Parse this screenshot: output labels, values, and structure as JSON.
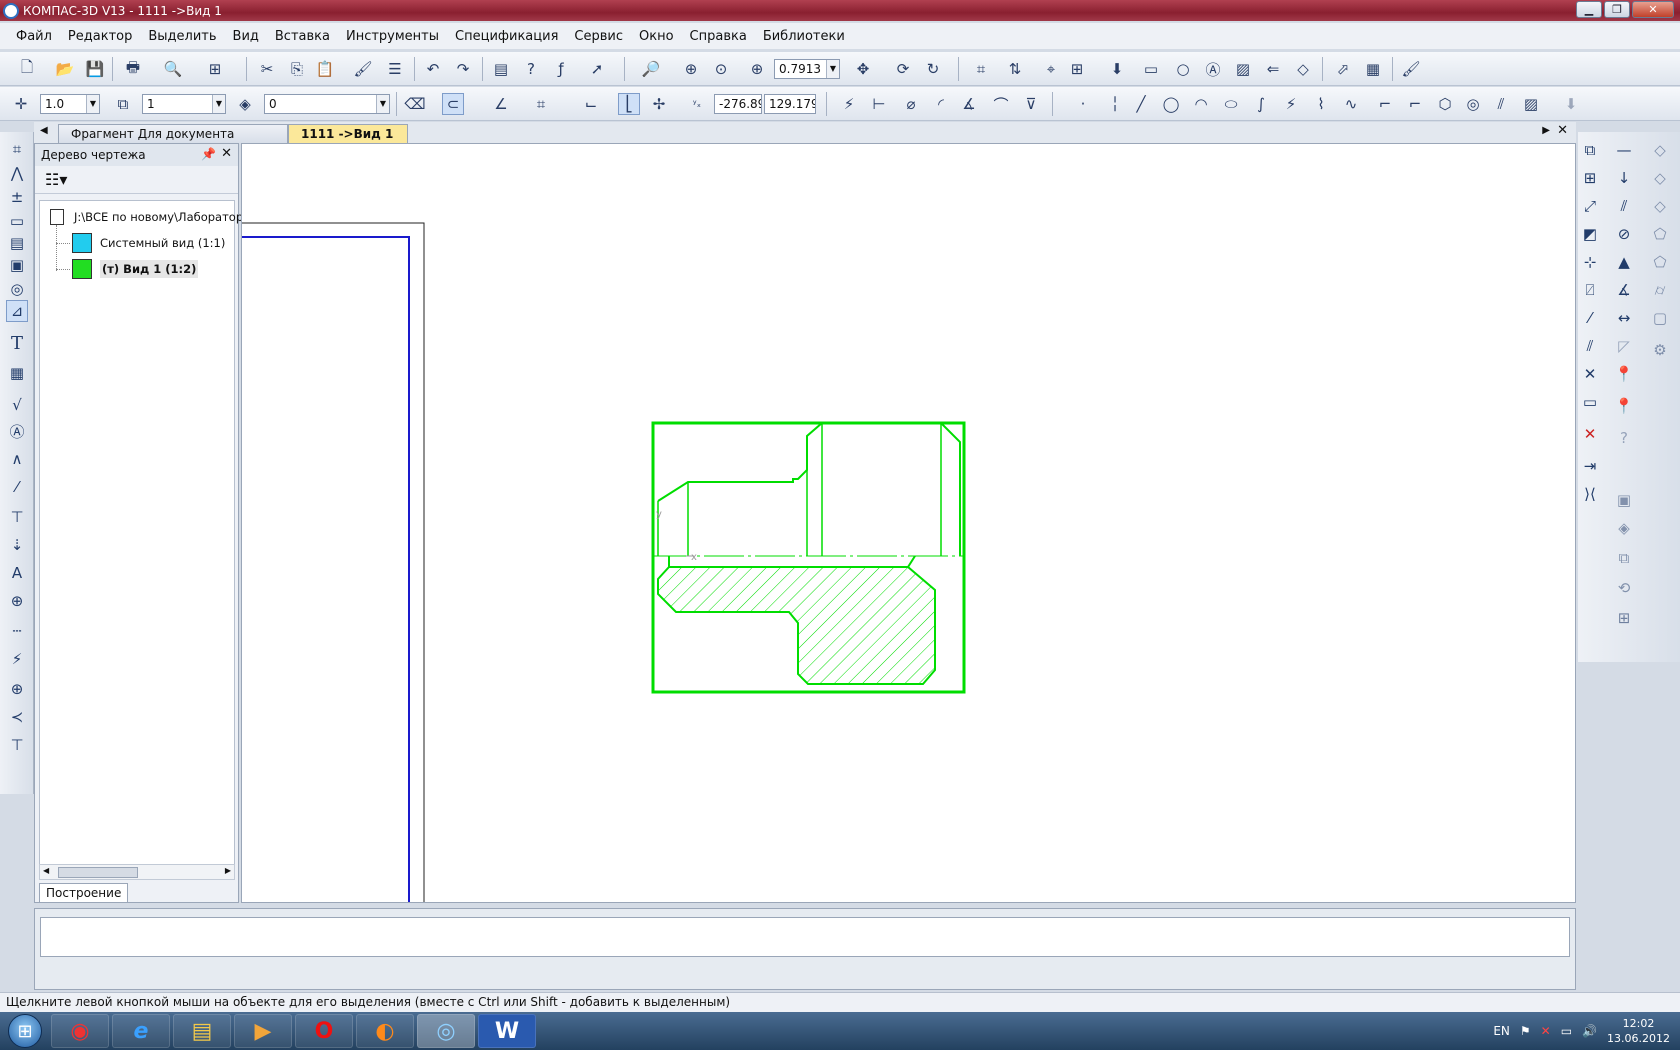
{
  "window": {
    "title": "КОМПАС-3D V13 - 1111 ->Вид 1"
  },
  "menu": {
    "items": [
      "Файл",
      "Редактор",
      "Выделить",
      "Вид",
      "Вставка",
      "Инструменты",
      "Спецификация",
      "Сервис",
      "Окно",
      "Справка",
      "Библиотеки"
    ]
  },
  "toolbar1": {
    "zoom_value": "0.7913"
  },
  "toolbar2": {
    "line_scale": "1.0",
    "layer_value": "1",
    "style_value": "0",
    "coord_x": "-276.89",
    "coord_y": "129.179"
  },
  "tabs": {
    "tab1": "Фрагмент Для документа",
    "tab2": "1111 ->Вид 1"
  },
  "tree": {
    "title": "Дерево чертежа",
    "root_path": "J:\\ВСЕ по новому\\Лаборатор",
    "node1": "Системный вид (1:1)",
    "node2": "(т) Вид 1 (1:2)",
    "bottom_tab": "Построение"
  },
  "drawing": {
    "axis_y": "y",
    "axis_x": "x"
  },
  "status": {
    "hint": "Щелкните левой кнопкой мыши на объекте для его выделения (вместе с Ctrl или Shift - добавить к выделенным)"
  },
  "taskbar": {
    "lang": "EN",
    "time": "12:02",
    "date": "13.06.2012"
  },
  "colors": {
    "drawing_green": "#00dd00",
    "frame_blue": "#1a1acc"
  }
}
